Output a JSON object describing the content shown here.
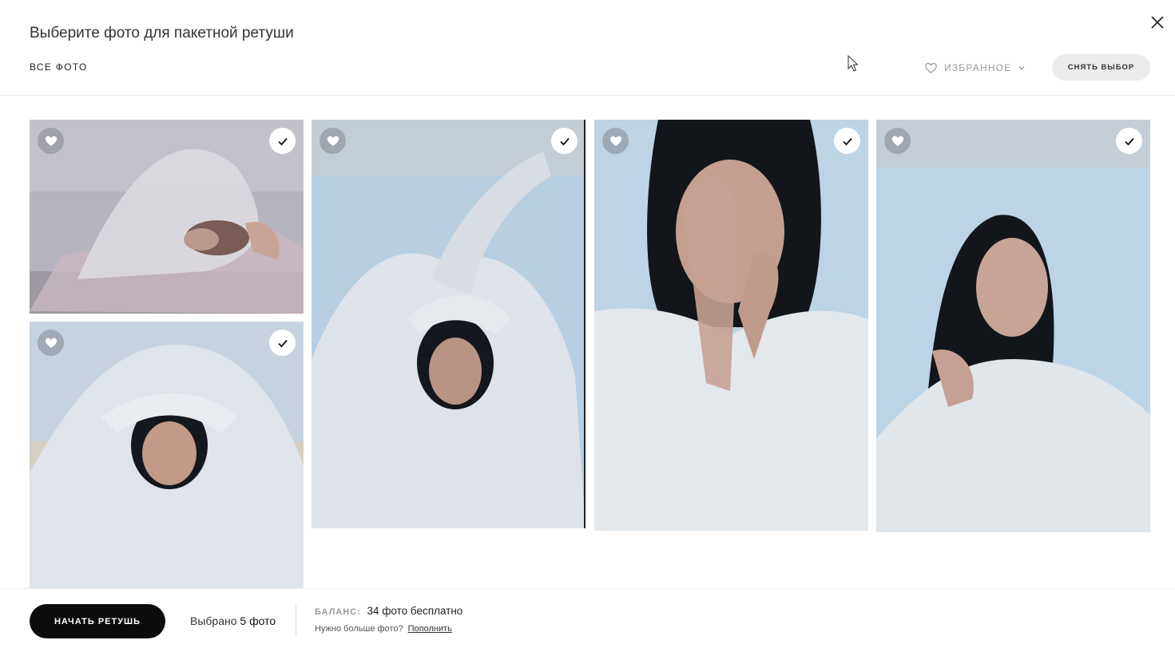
{
  "header": {
    "title": "Выберите фото для пакетной ретуши",
    "all_photos_label": "ВСЕ ФОТО",
    "favorites_label": "ИЗБРАННОЕ",
    "deselect_label": "СНЯТЬ ВЫБОР"
  },
  "photos": [
    {
      "id": 1,
      "favorite": false,
      "selected": true
    },
    {
      "id": 2,
      "favorite": false,
      "selected": true
    },
    {
      "id": 3,
      "favorite": false,
      "selected": true
    },
    {
      "id": 4,
      "favorite": false,
      "selected": true
    },
    {
      "id": 5,
      "favorite": false,
      "selected": true
    }
  ],
  "footer": {
    "start_label": "НАЧАТЬ РЕТУШЬ",
    "selected_prefix": "Выбрано",
    "selected_count": "5 фото",
    "balance_label": "БАЛАНС:",
    "balance_value": "34 фото бесплатно",
    "need_more": "Нужно больше фото?",
    "topup_link": "Пополнить"
  },
  "colors": {
    "accent_dark": "#0c0c0c",
    "pill_bg": "#ececec",
    "muted_text": "#9a9a9a"
  }
}
